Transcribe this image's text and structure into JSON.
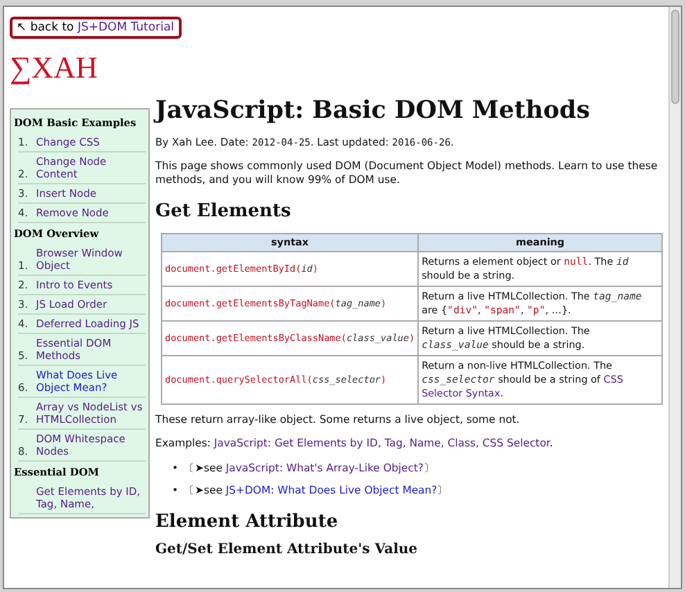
{
  "back_link": {
    "prefix": "↖ back to ",
    "link": "JS+DOM Tutorial"
  },
  "logo": "∑XAH",
  "sidebar": {
    "sections": [
      {
        "title": "DOM Basic Examples",
        "items": [
          {
            "number": "1.",
            "label": "Change CSS",
            "visited": true
          },
          {
            "number": "2.",
            "label": "Change Node Content",
            "visited": true
          },
          {
            "number": "3.",
            "label": "Insert Node",
            "visited": true
          },
          {
            "number": "4.",
            "label": "Remove Node",
            "visited": true
          }
        ]
      },
      {
        "title": "DOM Overview",
        "items": [
          {
            "number": "1.",
            "label": "Browser Window Object",
            "visited": true
          },
          {
            "number": "2.",
            "label": "Intro to Events",
            "visited": true
          },
          {
            "number": "3.",
            "label": "JS Load Order",
            "visited": true
          },
          {
            "number": "4.",
            "label": "Deferred Loading JS",
            "visited": true
          },
          {
            "number": "5.",
            "label": "Essential DOM Methods",
            "visited": true
          },
          {
            "number": "6.",
            "label": "What Does Live Object Mean?",
            "visited": false
          },
          {
            "number": "7.",
            "label": "Array vs NodeList vs HTMLCollection",
            "visited": true
          },
          {
            "number": "8.",
            "label": "DOM Whitespace Nodes",
            "visited": true
          }
        ]
      },
      {
        "title": "Essential DOM",
        "items": [
          {
            "label": "Get Elements by ID, Tag, Name,",
            "visited": true
          }
        ]
      }
    ]
  },
  "title": "JavaScript: Basic DOM Methods",
  "byline": [
    {
      "kind": "text",
      "text": "By Xah Lee. Date: "
    },
    {
      "kind": "date",
      "text": "2012-04-25"
    },
    {
      "kind": "text",
      "text": ". Last updated: "
    },
    {
      "kind": "date",
      "text": "2016-06-26"
    },
    {
      "kind": "text",
      "text": "."
    }
  ],
  "intro": "This page shows commonly used DOM (Document Object Model) methods. Learn to use these methods, and you will know 99% of DOM use.",
  "section_1": "Get Elements",
  "table": {
    "columns": [
      "syntax",
      "meaning"
    ],
    "rows": [
      {
        "syntax": [
          {
            "kind": "code",
            "text": "document.getElementById("
          },
          {
            "kind": "var",
            "text": "id"
          },
          {
            "kind": "code",
            "text": ")"
          }
        ],
        "meaning": [
          {
            "kind": "text",
            "text": "Returns a element object or "
          },
          {
            "kind": "code",
            "text": "null"
          },
          {
            "kind": "text",
            "text": ". The "
          },
          {
            "kind": "var",
            "text": "id"
          },
          {
            "kind": "text",
            "text": " should be a string."
          }
        ]
      },
      {
        "syntax": [
          {
            "kind": "code",
            "text": "document.getElementsByTagName("
          },
          {
            "kind": "var",
            "text": "tag_name"
          },
          {
            "kind": "code",
            "text": ")"
          }
        ],
        "meaning": [
          {
            "kind": "text",
            "text": "Return a live HTMLCollection. The "
          },
          {
            "kind": "var",
            "text": "tag_name"
          },
          {
            "kind": "text",
            "text": " are {"
          },
          {
            "kind": "code",
            "text": "\"div\""
          },
          {
            "kind": "text",
            "text": ", "
          },
          {
            "kind": "code",
            "text": "\"span\""
          },
          {
            "kind": "text",
            "text": ", "
          },
          {
            "kind": "code",
            "text": "\"p\""
          },
          {
            "kind": "text",
            "text": ", …}."
          }
        ]
      },
      {
        "syntax": [
          {
            "kind": "code",
            "text": "document.getElementsByClassName("
          },
          {
            "kind": "var",
            "text": "class_value"
          },
          {
            "kind": "code",
            "text": ")"
          }
        ],
        "meaning": [
          {
            "kind": "text",
            "text": "Return a live HTMLCollection. The "
          },
          {
            "kind": "var",
            "text": "class_value"
          },
          {
            "kind": "text",
            "text": " should be a string."
          }
        ]
      },
      {
        "syntax": [
          {
            "kind": "code",
            "text": "document.querySelectorAll("
          },
          {
            "kind": "var",
            "text": "css_selector"
          },
          {
            "kind": "code",
            "text": ")"
          }
        ],
        "meaning": [
          {
            "kind": "text",
            "text": "Return a non-live HTMLCollection. The "
          },
          {
            "kind": "var",
            "text": "css_selector"
          },
          {
            "kind": "text",
            "text": " should be a string of "
          },
          {
            "kind": "link",
            "text": "CSS Selector Syntax"
          },
          {
            "kind": "text",
            "text": "."
          }
        ]
      }
    ]
  },
  "note": "These return array-like object. Some returns a live object, some not.",
  "examples": {
    "prefix": "Examples: ",
    "link": "JavaScript: Get Elements by ID, Tag, Name, Class, CSS Selector",
    "suffix": "."
  },
  "see_also": [
    {
      "bullet": "•",
      "prefix": "〔➤see ",
      "link": "JavaScript: What's Array-Like Object?",
      "suffix": "〕",
      "visited": true
    },
    {
      "bullet": "•",
      "prefix": "〔➤see ",
      "link": "JS+DOM: What Does Live Object Mean?",
      "suffix": "〕",
      "visited": false
    }
  ],
  "section_2": "Element Attribute",
  "subsection": "Get/Set Element Attribute's Value"
}
